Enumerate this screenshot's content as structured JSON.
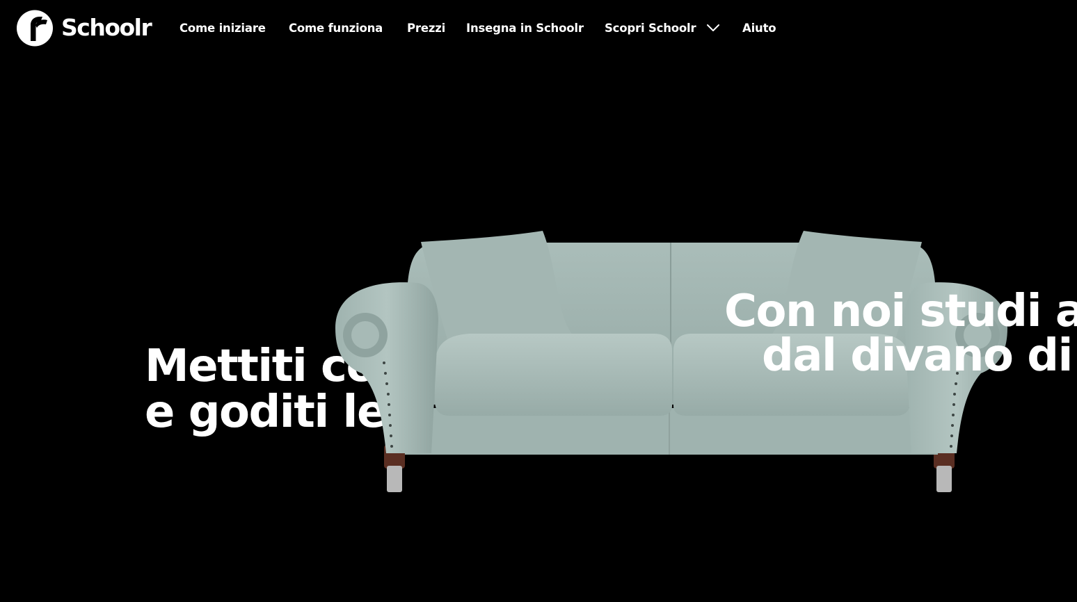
{
  "brand": {
    "name": "Schoolr",
    "logo_icon": "schoolr-logo-icon"
  },
  "nav": {
    "items": [
      {
        "label": "Come iniziare"
      },
      {
        "label": "Come funziona"
      },
      {
        "label": "Prezzi"
      },
      {
        "label": "Insegna in Schoolr"
      },
      {
        "label": "Scopri Schoolr",
        "icon": "chevron-down-icon"
      },
      {
        "label": "Aiuto"
      }
    ]
  },
  "hero": {
    "left_line1": "Mettiti co",
    "left_line2": "e goditi le",
    "right_line1": "Con noi studi an",
    "right_line2": "dal divano di c",
    "image": "sofa-illustration"
  },
  "colors": {
    "background": "#000000",
    "text": "#ffffff",
    "sofa": "#a9bcb8"
  }
}
